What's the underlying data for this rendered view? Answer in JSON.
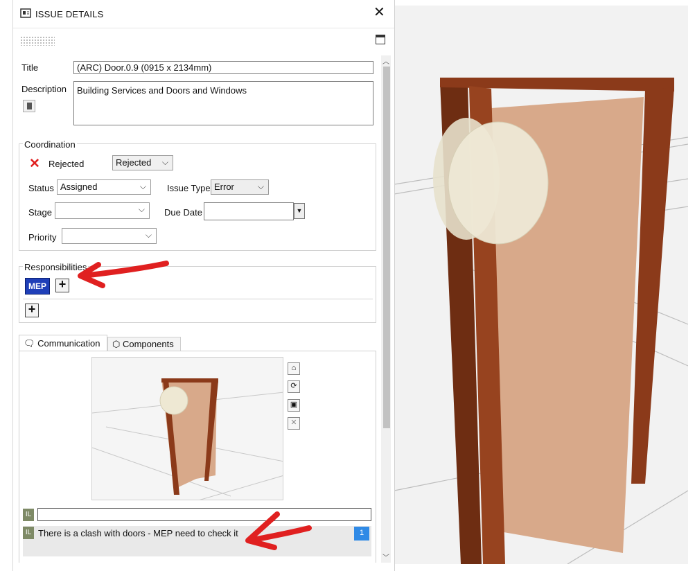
{
  "window": {
    "title": "ISSUE DETAILS",
    "close_glyph": "✕"
  },
  "issue": {
    "title_label": "Title",
    "title_value": "(ARC) Door.0.9 (0915 x 2134mm)",
    "description_label": "Description",
    "description_value": "Building Services and Doors and Windows"
  },
  "coordination": {
    "legend": "Coordination",
    "state_text": "Rejected",
    "state_dropdown": "Rejected",
    "status_label": "Status",
    "status_value": "Assigned",
    "issue_type_label": "Issue Type",
    "issue_type_value": "Error",
    "stage_label": "Stage",
    "stage_value": "",
    "due_date_label": "Due Date",
    "due_date_value": "",
    "priority_label": "Priority",
    "priority_value": ""
  },
  "responsibilities": {
    "legend": "Responsibilities",
    "badge": "MEP",
    "add_glyph": "+"
  },
  "tabs": [
    {
      "label": "Communication",
      "icon": "speech-bubble-icon",
      "active": true
    },
    {
      "label": "Components",
      "icon": "cube-icon",
      "active": false
    }
  ],
  "snapshot_tools": [
    "camera-view-icon",
    "refresh-icon",
    "image-icon",
    "delete-icon"
  ],
  "comments": {
    "input_value": "",
    "author_initials": "IL",
    "items": [
      {
        "initials": "IL",
        "text": "There is a clash with doors - MEP need to check it",
        "count": "1"
      }
    ]
  },
  "colors": {
    "door_frame": "#8b3a1a",
    "door_leaf": "#d8a98a",
    "mep_badge": "#1f3fb8",
    "annotation_arrow": "#e02020",
    "reject_icon": "#e02020",
    "count_badge": "#2f8ae6"
  }
}
